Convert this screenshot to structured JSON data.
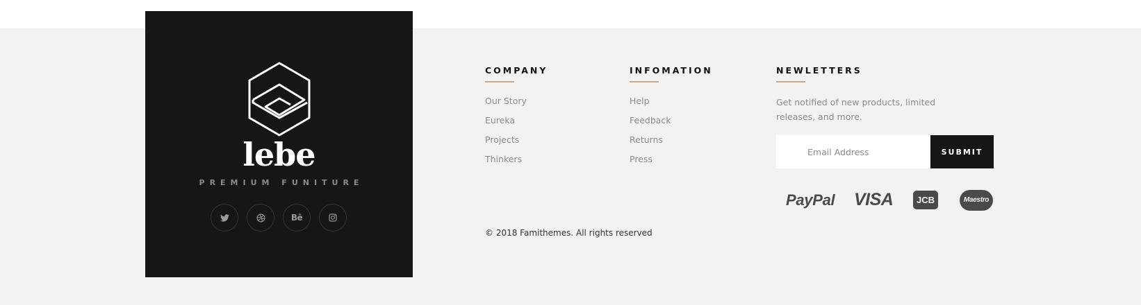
{
  "brand": {
    "name": "lebe",
    "tagline": "PREMIUM FUNITURE",
    "socials": [
      {
        "icon": "twitter-icon"
      },
      {
        "icon": "dribbble-icon"
      },
      {
        "icon": "behance-icon",
        "glyph": "Bē"
      },
      {
        "icon": "instagram-icon"
      }
    ]
  },
  "company": {
    "heading": "COMPANY",
    "links": [
      "Our Story",
      "Eureka",
      "Projects",
      "Thinkers"
    ]
  },
  "information": {
    "heading": "INFOMATION",
    "links": [
      "Help",
      "Feedback",
      "Returns",
      "Press"
    ]
  },
  "newsletter": {
    "heading": "NEWLETTERS",
    "text": "Get notified of new products, limited releases, and more.",
    "email_placeholder": "Email Address",
    "submit_label": "SUBMIT"
  },
  "payments": {
    "paypal": "PayPal",
    "visa": "VISA",
    "jcb": "JCB",
    "maestro": "Maestro"
  },
  "copyright": "© 2018 Famithemes. All rights reserved",
  "colors": {
    "footer_bg": "#f2f2f2",
    "brand_box": "#161616",
    "accent_rule": "#c4a98d",
    "link_text": "#8a8a8a",
    "heading_text": "#111111"
  }
}
